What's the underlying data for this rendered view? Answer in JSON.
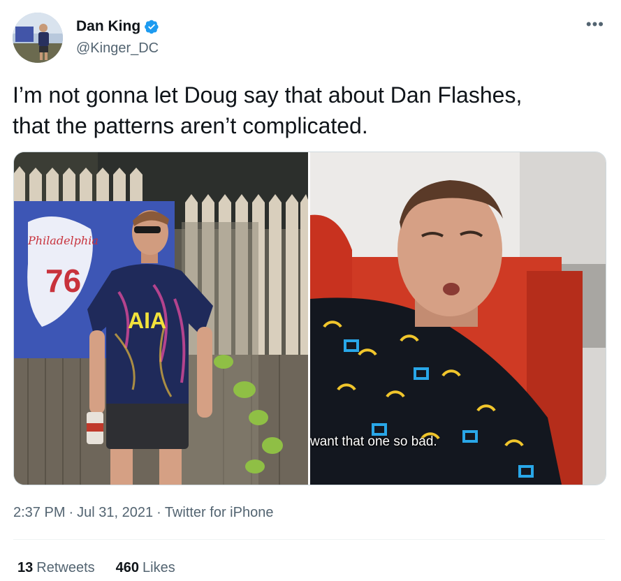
{
  "author": {
    "name": "Dan King",
    "handle": "@Kinger_DC",
    "verified": true,
    "avatar_icon": "profile-photo"
  },
  "more_label": "•••",
  "tweet": {
    "text_line1": "I’m not gonna let Doug say that about Dan Flashes,",
    "text_line2": "that the patterns aren’t complicated."
  },
  "media": {
    "left_photo": {
      "flag_script": "Philadelphia",
      "flag_number": "76",
      "shirt_text": "AIA"
    },
    "right_photo": {
      "caption": "want that one so bad."
    }
  },
  "meta": {
    "time": "2:37 PM",
    "date": "Jul 31, 2021",
    "source": "Twitter for iPhone",
    "separator": "·"
  },
  "stats": {
    "retweets_count": "13",
    "retweets_label": "Retweets",
    "likes_count": "460",
    "likes_label": "Likes"
  },
  "colors": {
    "verified_blue": "#1d9bf0",
    "secondary_text": "#536471",
    "primary_text": "#0f1419"
  }
}
